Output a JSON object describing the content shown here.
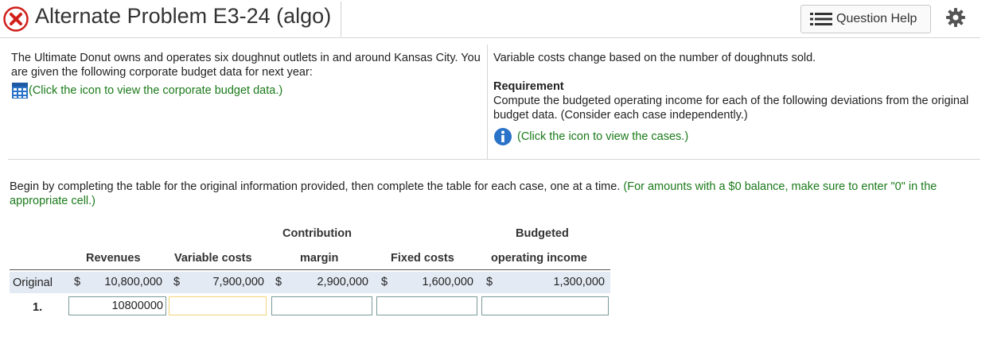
{
  "header": {
    "title": "Alternate Problem E3-24 (algo)",
    "question_help_label": "Question Help"
  },
  "left_panel": {
    "text": "The Ultimate Donut owns and operates six doughnut outlets in and around Kansas City. You are given the following corporate budget data for next year:",
    "link": "(Click the icon to view the corporate budget data.)"
  },
  "right_panel": {
    "text": "Variable costs change based on the number of doughnuts sold.",
    "requirement_title": "Requirement",
    "requirement_text": "Compute the budgeted operating income for each of the following deviations from the original budget data. (Consider each case independently.)",
    "link": "(Click the icon to view the cases.)"
  },
  "instructions": {
    "text": "Begin by completing the table for the original information provided, then complete the table for each case, one at a time.",
    "hint": "(For amounts with a $0 balance, make sure to enter \"0\" in the appropriate cell.)"
  },
  "table": {
    "headers": {
      "revenues": "Revenues",
      "variable_costs": "Variable costs",
      "contribution_top": "Contribution",
      "contribution_bottom": "margin",
      "fixed_costs": "Fixed costs",
      "budgeted_top": "Budgeted",
      "budgeted_bottom": "operating income"
    },
    "original": {
      "label": "Original",
      "currency": "$",
      "revenues": "10,800,000",
      "variable_costs": "7,900,000",
      "contribution_margin": "2,900,000",
      "fixed_costs": "1,600,000",
      "operating_income": "1,300,000"
    },
    "case1": {
      "label": "1.",
      "revenues": "10800000",
      "variable_costs": "",
      "contribution_margin": "",
      "fixed_costs": "",
      "operating_income": ""
    }
  },
  "colors": {
    "link_green": "#1a7a1a",
    "error_red": "#d0201a",
    "row_highlight": "#e4eaf4",
    "info_blue": "#2a73c8"
  }
}
